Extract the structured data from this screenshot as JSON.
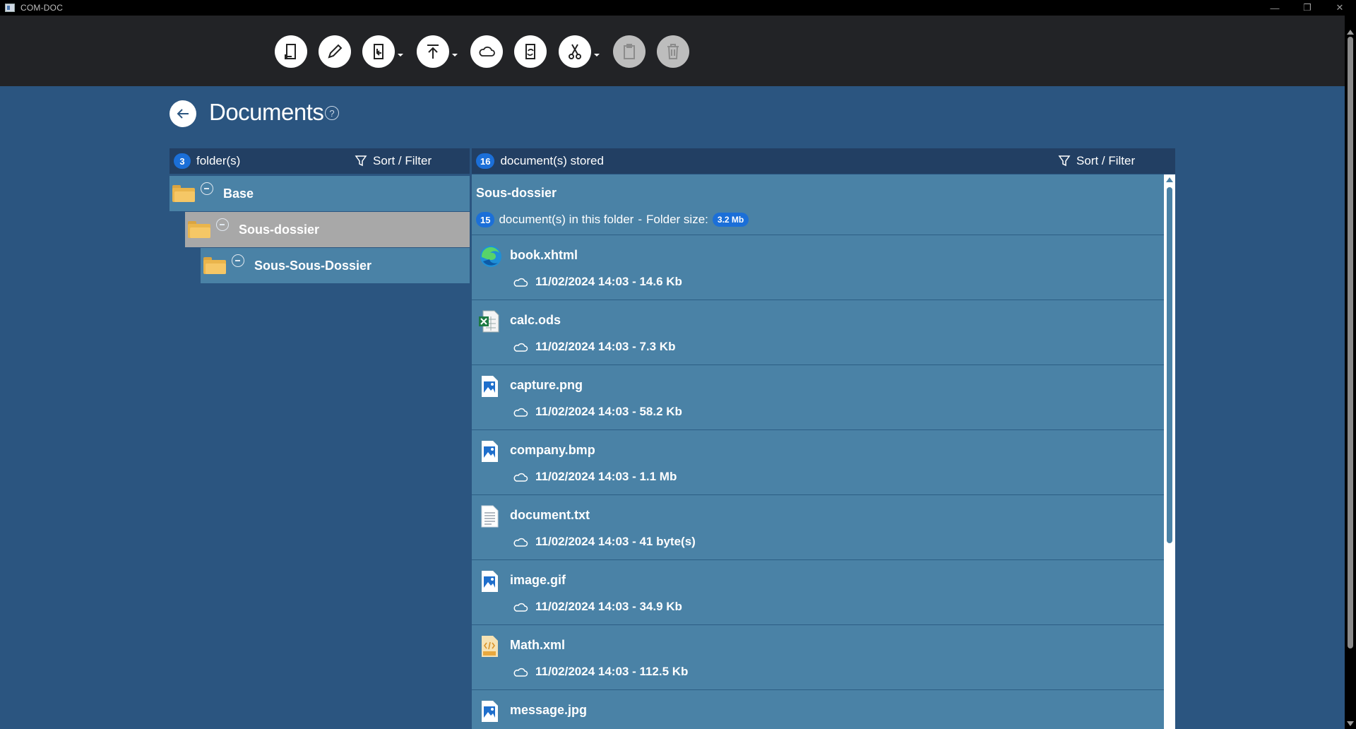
{
  "window": {
    "title": "COM-DOC",
    "minimize_glyph": "—",
    "restore_glyph": "❐",
    "close_glyph": "✕"
  },
  "toolbar": {
    "buttons": [
      {
        "icon": "new-document-icon",
        "enabled": true
      },
      {
        "icon": "edit-pencil-icon",
        "enabled": true
      },
      {
        "icon": "move-document-icon",
        "enabled": true,
        "dropdown": true
      },
      {
        "icon": "upload-icon",
        "enabled": true,
        "dropdown": true
      },
      {
        "icon": "cloud-icon",
        "enabled": true
      },
      {
        "icon": "sync-document-icon",
        "enabled": true
      },
      {
        "icon": "cut-scissors-icon",
        "enabled": true,
        "dropdown": true
      },
      {
        "icon": "paste-clipboard-icon",
        "enabled": false
      },
      {
        "icon": "trash-icon",
        "enabled": false
      }
    ]
  },
  "header": {
    "title": "Documents",
    "help": "?"
  },
  "folders_panel": {
    "count": "3",
    "count_label": "folder(s)",
    "sort_filter_label": "Sort / Filter",
    "tree": [
      {
        "name": "Base",
        "level": 0,
        "selected": false
      },
      {
        "name": "Sous-dossier",
        "level": 1,
        "selected": true
      },
      {
        "name": "Sous-Sous-Dossier",
        "level": 2,
        "selected": false
      }
    ]
  },
  "documents_panel": {
    "count": "16",
    "count_label": "document(s) stored",
    "sort_filter_label": "Sort / Filter",
    "folder_name": "Sous-dossier",
    "folder_doc_count": "15",
    "folder_doc_label": "document(s) in this folder",
    "separator": "-",
    "folder_size_label": "Folder size:",
    "folder_size": "3.2 Mb",
    "items": [
      {
        "name": "book.xhtml",
        "meta": "11/02/2024 14:03 - 14.6 Kb",
        "icon": "edge-browser-icon"
      },
      {
        "name": "calc.ods",
        "meta": "11/02/2024 14:03 - 7.3 Kb",
        "icon": "spreadsheet-icon"
      },
      {
        "name": "capture.png",
        "meta": "11/02/2024 14:03 - 58.2 Kb",
        "icon": "image-file-icon"
      },
      {
        "name": "company.bmp",
        "meta": "11/02/2024 14:03 - 1.1 Mb",
        "icon": "image-file-icon"
      },
      {
        "name": "document.txt",
        "meta": "11/02/2024 14:03 - 41 byte(s)",
        "icon": "text-file-icon"
      },
      {
        "name": "image.gif",
        "meta": "11/02/2024 14:03 - 34.9 Kb",
        "icon": "image-file-icon"
      },
      {
        "name": "Math.xml",
        "meta": "11/02/2024 14:03 - 112.5 Kb",
        "icon": "xml-file-icon"
      },
      {
        "name": "message.jpg",
        "meta": "",
        "icon": "image-file-icon"
      }
    ]
  },
  "colors": {
    "background": "#2b5580",
    "toolbar": "#222326",
    "panel_header": "#223f63",
    "list_bg": "#4a82a6",
    "selected_folder": "#a8a8a8",
    "badge": "#1b6fd8",
    "folder": "#f5c766"
  }
}
